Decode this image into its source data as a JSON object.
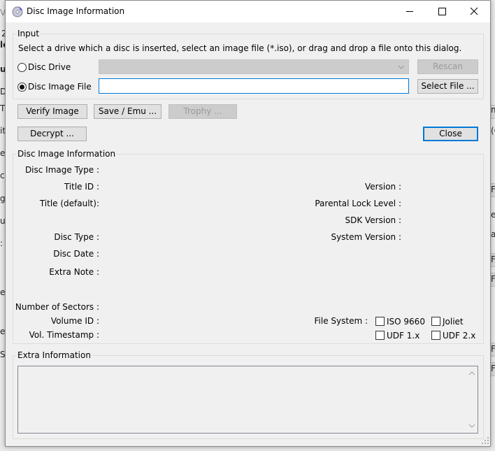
{
  "background": {
    "fragments_left": [
      "V",
      "2",
      "le",
      "u",
      "Di",
      "T",
      "it",
      "e",
      "c",
      "g",
      "uc",
      ":",
      "e",
      "e",
      "Sy"
    ],
    "fragments_right": [
      "m",
      "(C",
      "F",
      "e",
      "a",
      "Fi",
      "Fi",
      "Fi",
      "Fi"
    ]
  },
  "dialog": {
    "title": "Disc Image Information",
    "caption": {
      "minimize": "—",
      "maximize": "☐",
      "close": "✕"
    }
  },
  "input_group": {
    "label": "Input",
    "instruction": "Select a drive which a disc is inserted, select an image file (*.iso), or drag and drop a file onto this dialog.",
    "disc_drive": {
      "label": "Disc Drive",
      "selected": false,
      "value": ""
    },
    "rescan_label": "Rescan",
    "disc_image_file": {
      "label": "Disc Image File",
      "selected": true,
      "value": ""
    },
    "select_file_label": "Select File ..."
  },
  "actions": {
    "verify_image": "Verify Image",
    "save_emu": "Save / Emu ...",
    "trophy": "Trophy ...",
    "decrypt": "Decrypt ...",
    "close": "Close"
  },
  "info_group": {
    "label": "Disc Image Information",
    "disc_image_type": "Disc Image Type :",
    "title_id": "Title ID :",
    "title_default": "Title (default):",
    "disc_type": "Disc Type :",
    "disc_date": "Disc Date :",
    "extra_note": "Extra Note :",
    "version": "Version :",
    "parental_lock": "Parental Lock Level :",
    "sdk_version": "SDK Version :",
    "system_version": "System Version :",
    "number_of_sectors": "Number of Sectors :",
    "volume_id": "Volume ID :",
    "vol_timestamp": "Vol. Timestamp :",
    "file_system": "File System :",
    "fs_options": {
      "iso9660": "ISO 9660",
      "joliet": "Joliet",
      "udf1": "UDF 1.x",
      "udf2": "UDF 2.x"
    }
  },
  "extra_group": {
    "label": "Extra Information",
    "scroll_up": "^",
    "scroll_down": "v"
  },
  "colors": {
    "accent": "#0078d7",
    "dialog_bg": "#f0f0f0",
    "disabled_text": "#9a9a9a"
  }
}
